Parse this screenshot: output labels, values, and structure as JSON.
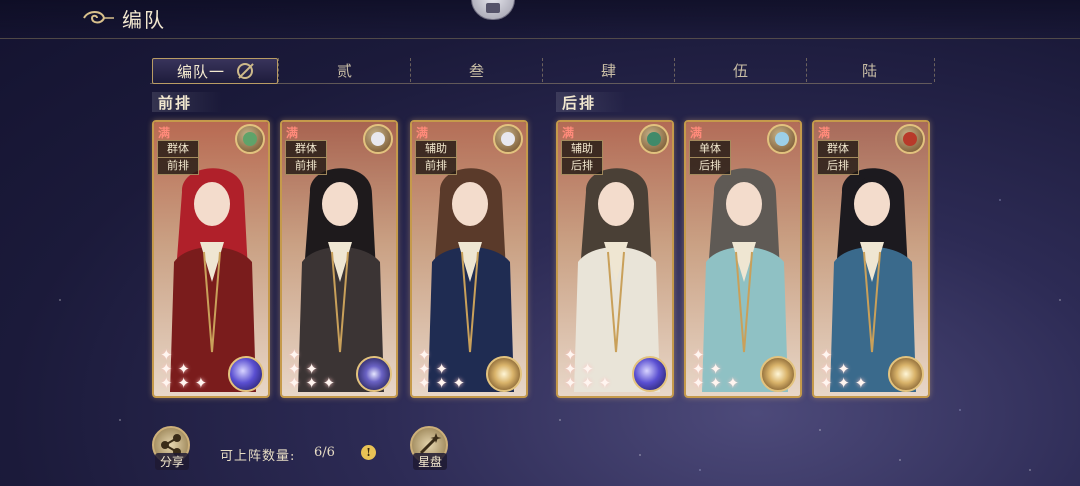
{
  "header": {
    "title": "编队"
  },
  "tabs": [
    {
      "label": "编队一",
      "active": true
    },
    {
      "label": "贰",
      "active": false
    },
    {
      "label": "叁",
      "active": false
    },
    {
      "label": "肆",
      "active": false
    },
    {
      "label": "伍",
      "active": false
    },
    {
      "label": "陆",
      "active": false
    }
  ],
  "rows": {
    "front": "前排",
    "back": "后排"
  },
  "cards": [
    {
      "badge": "满",
      "tags": [
        "群体",
        "前排"
      ],
      "element_icon": "dragon-icon",
      "orb_icon": "cosmic-orb-icon",
      "hair": "#b0202a",
      "outfit": "#7a1c1c",
      "bg": "#b86a52"
    },
    {
      "badge": "满",
      "tags": [
        "群体",
        "前排"
      ],
      "element_icon": "crane-icon",
      "orb_icon": "dark-orb-icon",
      "hair": "#1e1a1c",
      "outfit": "#3b3434",
      "bg": "#a86350"
    },
    {
      "badge": "满",
      "tags": [
        "辅助",
        "前排"
      ],
      "element_icon": "crane-icon",
      "orb_icon": "gold-orb-icon",
      "hair": "#5a3a2a",
      "outfit": "#1f2c52",
      "bg": "#b46e57"
    },
    {
      "badge": "满",
      "tags": [
        "辅助",
        "后排"
      ],
      "element_icon": "bird-icon",
      "orb_icon": "cosmic-orb-icon",
      "hair": "#4a4036",
      "outfit": "#e9e4d8",
      "bg": "#b26a55"
    },
    {
      "badge": "满",
      "tags": [
        "单体",
        "后排"
      ],
      "element_icon": "qilin-icon",
      "orb_icon": "gold-orb-icon",
      "hair": "#5f5a55",
      "outfit": "#8fc1c4",
      "bg": "#b26c58"
    },
    {
      "badge": "满",
      "tags": [
        "群体",
        "后排"
      ],
      "element_icon": "swirl-icon",
      "orb_icon": "gold-orb-icon",
      "hair": "#1c1a1f",
      "outfit": "#3a6a8c",
      "bg": "#a86a5a"
    }
  ],
  "bottom": {
    "share_label": "分享",
    "deploy_label": "可上阵数量:",
    "deploy_count": "6/6",
    "info_symbol": "!",
    "star_label": "星盘"
  }
}
